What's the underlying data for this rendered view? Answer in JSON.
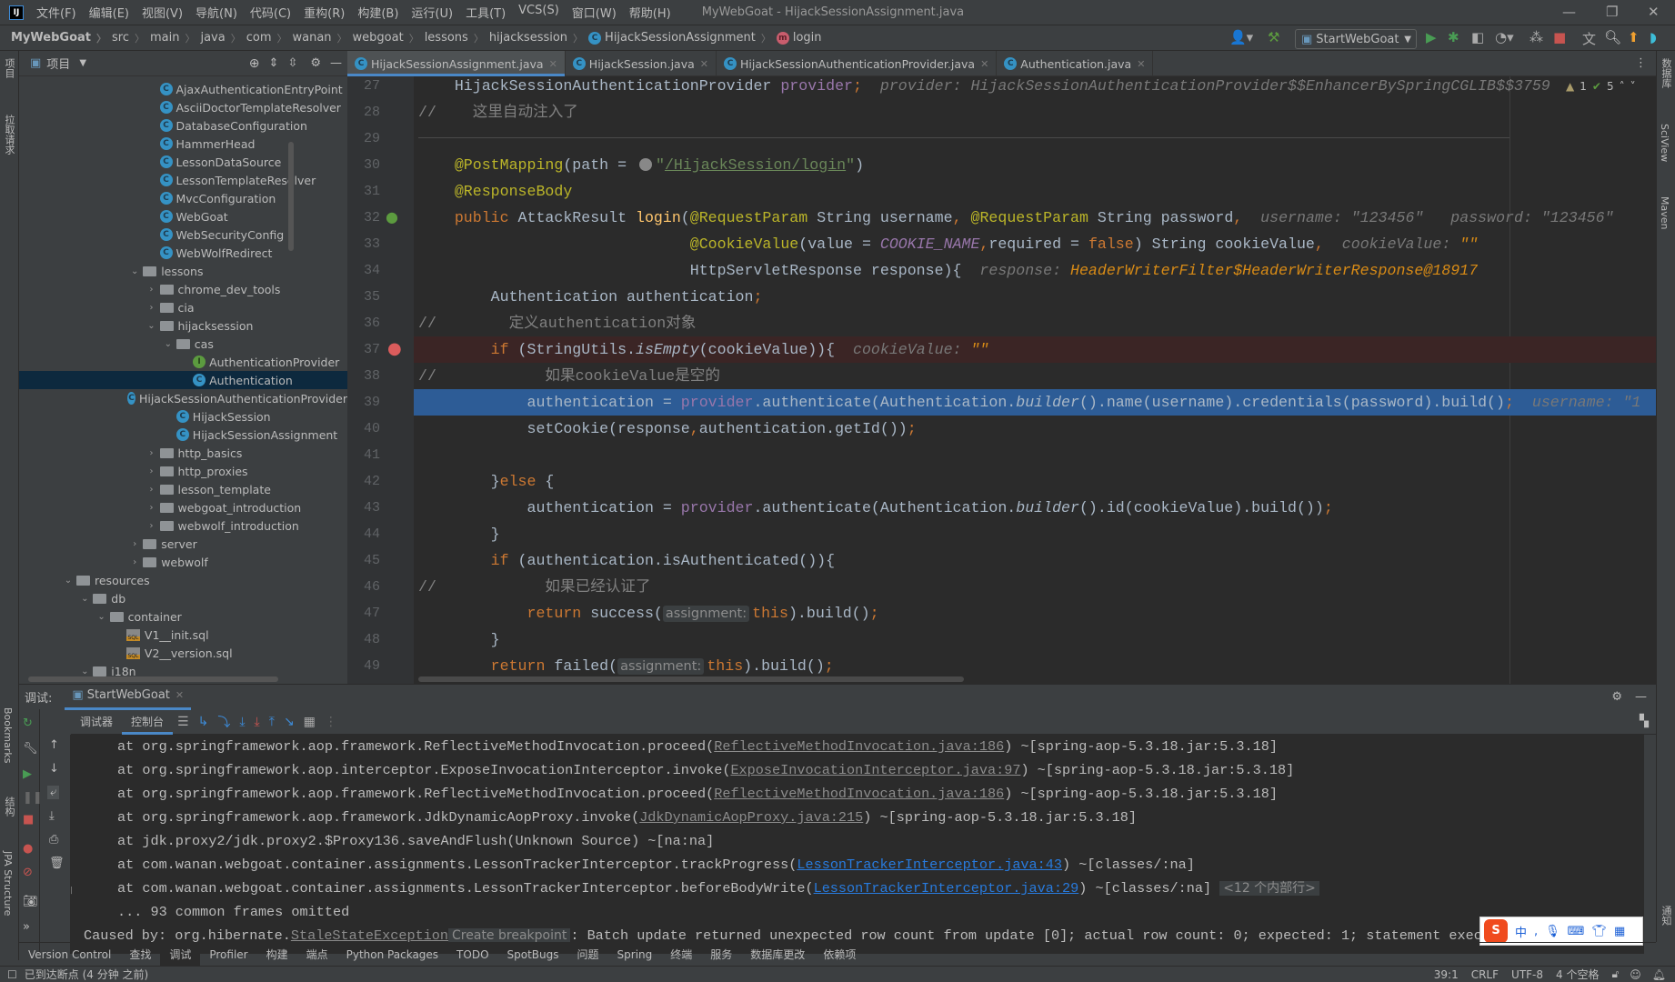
{
  "window": {
    "title": "MyWebGoat - HijackSessionAssignment.java",
    "logo": "IJ"
  },
  "menu": [
    "文件(F)",
    "编辑(E)",
    "视图(V)",
    "导航(N)",
    "代码(C)",
    "重构(R)",
    "构建(B)",
    "运行(U)",
    "工具(T)",
    "VCS(S)",
    "窗口(W)",
    "帮助(H)"
  ],
  "breadcrumb": [
    "MyWebGoat",
    "src",
    "main",
    "java",
    "com",
    "wanan",
    "webgoat",
    "lessons",
    "hijacksession"
  ],
  "breadcrumb_class": "HijackSessionAssignment",
  "breadcrumb_method": "login",
  "toolbar": {
    "run_config": "StartWebGoat"
  },
  "project": {
    "title": "项目",
    "tree": [
      {
        "label": "AjaxAuthenticationEntryPoint",
        "level": 5,
        "type": "class"
      },
      {
        "label": "AsciiDoctorTemplateResolver",
        "level": 5,
        "type": "class"
      },
      {
        "label": "DatabaseConfiguration",
        "level": 5,
        "type": "class"
      },
      {
        "label": "HammerHead",
        "level": 5,
        "type": "class"
      },
      {
        "label": "LessonDataSource",
        "level": 5,
        "type": "class"
      },
      {
        "label": "LessonTemplateResolver",
        "level": 5,
        "type": "class"
      },
      {
        "label": "MvcConfiguration",
        "level": 5,
        "type": "class"
      },
      {
        "label": "WebGoat",
        "level": 5,
        "type": "class"
      },
      {
        "label": "WebSecurityConfig",
        "level": 5,
        "type": "class"
      },
      {
        "label": "WebWolfRedirect",
        "level": 5,
        "type": "class"
      },
      {
        "label": "lessons",
        "level": 4,
        "type": "folder",
        "expanded": true
      },
      {
        "label": "chrome_dev_tools",
        "level": 5,
        "type": "folder",
        "expanded": false
      },
      {
        "label": "cia",
        "level": 5,
        "type": "folder",
        "expanded": false
      },
      {
        "label": "hijacksession",
        "level": 5,
        "type": "folder",
        "expanded": true
      },
      {
        "label": "cas",
        "level": 6,
        "type": "folder",
        "expanded": true
      },
      {
        "label": "AuthenticationProvider",
        "level": 7,
        "type": "interface"
      },
      {
        "label": "Authentication",
        "level": 7,
        "type": "class",
        "selected": true
      },
      {
        "label": "HijackSessionAuthenticationProvider",
        "level": 7,
        "type": "class"
      },
      {
        "label": "HijackSession",
        "level": 6,
        "type": "class"
      },
      {
        "label": "HijackSessionAssignment",
        "level": 6,
        "type": "class"
      },
      {
        "label": "http_basics",
        "level": 5,
        "type": "folder",
        "expanded": false
      },
      {
        "label": "http_proxies",
        "level": 5,
        "type": "folder",
        "expanded": false
      },
      {
        "label": "lesson_template",
        "level": 5,
        "type": "folder",
        "expanded": false
      },
      {
        "label": "webgoat_introduction",
        "level": 5,
        "type": "folder",
        "expanded": false
      },
      {
        "label": "webwolf_introduction",
        "level": 5,
        "type": "folder",
        "expanded": false
      },
      {
        "label": "server",
        "level": 4,
        "type": "folder",
        "expanded": false
      },
      {
        "label": "webwolf",
        "level": 4,
        "type": "folder",
        "expanded": false
      },
      {
        "label": "resources",
        "level": 0,
        "type": "folder",
        "expanded": true
      },
      {
        "label": "db",
        "level": 1,
        "type": "folder",
        "expanded": true
      },
      {
        "label": "container",
        "level": 2,
        "type": "folder",
        "expanded": true
      },
      {
        "label": "V1__init.sql",
        "level": 3,
        "type": "sql"
      },
      {
        "label": "V2__version.sql",
        "level": 3,
        "type": "sql"
      },
      {
        "label": "i18n",
        "level": 1,
        "type": "folder",
        "expanded": true
      }
    ]
  },
  "tabs": [
    {
      "label": "HijackSessionAssignment.java",
      "active": true
    },
    {
      "label": "HijackSession.java"
    },
    {
      "label": "HijackSessionAuthenticationProvider.java"
    },
    {
      "label": "Authentication.java"
    }
  ],
  "editor": {
    "inspections": {
      "warnings": "1",
      "ok": "5"
    },
    "breakpoint_line": 37,
    "current_line": 39,
    "lines": [
      {
        "n": 27,
        "t": [
          [
            "p",
            "    HijackSessionAuthenticationProvider "
          ],
          [
            "f",
            "provider"
          ],
          [
            "k",
            ";"
          ],
          [
            "h",
            "  provider: HijackSessionAuthenticationProvider$$EnhancerBySpringCGLIB$$3759"
          ]
        ]
      },
      {
        "n": 28,
        "t": [
          [
            "c",
            "//    这里自动注入了"
          ]
        ]
      },
      {
        "n": 29,
        "t": []
      },
      {
        "n": 30,
        "t": [
          [
            "a",
            "    @PostMapping"
          ],
          [
            "p",
            "(path = "
          ],
          [
            "g",
            ""
          ],
          [
            "s",
            "\""
          ],
          [
            "u",
            "/HijackSession/login"
          ],
          [
            "s",
            "\""
          ],
          [
            "p",
            ")"
          ]
        ]
      },
      {
        "n": 31,
        "t": [
          [
            "a",
            "    @ResponseBody"
          ]
        ]
      },
      {
        "n": 32,
        "t": [
          [
            "k",
            "    public "
          ],
          [
            "p",
            "AttackResult "
          ],
          [
            "m",
            "login"
          ],
          [
            "p",
            "("
          ],
          [
            "a",
            "@RequestParam "
          ],
          [
            "p",
            "String username"
          ],
          [
            "k",
            ", "
          ],
          [
            "a",
            "@RequestParam "
          ],
          [
            "p",
            "String password"
          ],
          [
            "k",
            ","
          ],
          [
            "h",
            "  username: \"123456\"   password: \"123456\""
          ]
        ]
      },
      {
        "n": 33,
        "t": [
          [
            "p",
            "                              "
          ],
          [
            "a",
            "@CookieValue"
          ],
          [
            "p",
            "(value = "
          ],
          [
            "fi",
            "COOKIE_NAME"
          ],
          [
            "k",
            ","
          ],
          [
            "p",
            "required = "
          ],
          [
            "k",
            "false"
          ],
          [
            "p",
            ") String cookieValue"
          ],
          [
            "k",
            ","
          ],
          [
            "h",
            "  cookieValue: "
          ],
          [
            "hv",
            "\"\""
          ]
        ]
      },
      {
        "n": 34,
        "t": [
          [
            "p",
            "                              HttpServletResponse response){"
          ],
          [
            "h",
            "  response: "
          ],
          [
            "hv",
            "HeaderWriterFilter$HeaderWriterResponse@18917"
          ]
        ]
      },
      {
        "n": 35,
        "t": [
          [
            "p",
            "        Authentication authentication"
          ],
          [
            "k",
            ";"
          ]
        ]
      },
      {
        "n": 36,
        "t": [
          [
            "c",
            "//        定义authentication对象"
          ]
        ]
      },
      {
        "n": 37,
        "t": [
          [
            "k",
            "        if "
          ],
          [
            "p",
            "(StringUtils."
          ],
          [
            "i",
            "isEmpty"
          ],
          [
            "p",
            "(cookieValue)){"
          ],
          [
            "h",
            "  cookieValue: "
          ],
          [
            "hv",
            "\"\""
          ]
        ]
      },
      {
        "n": 38,
        "t": [
          [
            "c",
            "//            如果cookieValue是空的"
          ]
        ]
      },
      {
        "n": 39,
        "t": [
          [
            "p",
            "            authentication = "
          ],
          [
            "f",
            "provider"
          ],
          [
            "p",
            ".authenticate(Authentication."
          ],
          [
            "i",
            "builder"
          ],
          [
            "p",
            "().name(username).credentials(password).build()"
          ],
          [
            "k",
            ";"
          ],
          [
            "h",
            "  username: \"1"
          ]
        ]
      },
      {
        "n": 40,
        "t": [
          [
            "p",
            "            setCookie(response"
          ],
          [
            "k",
            ","
          ],
          [
            "p",
            "authentication.getId())"
          ],
          [
            "k",
            ";"
          ]
        ]
      },
      {
        "n": 41,
        "t": []
      },
      {
        "n": 42,
        "t": [
          [
            "p",
            "        }"
          ],
          [
            "k",
            "else "
          ],
          [
            "p",
            "{"
          ]
        ]
      },
      {
        "n": 43,
        "t": [
          [
            "p",
            "            authentication = "
          ],
          [
            "f",
            "provider"
          ],
          [
            "p",
            ".authenticate(Authentication."
          ],
          [
            "i",
            "builder"
          ],
          [
            "p",
            "().id(cookieValue).build())"
          ],
          [
            "k",
            ";"
          ]
        ]
      },
      {
        "n": 44,
        "t": [
          [
            "p",
            "        }"
          ]
        ]
      },
      {
        "n": 45,
        "t": [
          [
            "k",
            "        if "
          ],
          [
            "p",
            "(authentication.isAuthenticated()){"
          ]
        ]
      },
      {
        "n": 46,
        "t": [
          [
            "c",
            "//            如果已经认证了"
          ]
        ]
      },
      {
        "n": 47,
        "t": [
          [
            "k",
            "            return "
          ],
          [
            "p",
            "success("
          ],
          [
            "b",
            "assignment:"
          ],
          [
            "k",
            "this"
          ],
          [
            "p",
            ").build()"
          ],
          [
            "k",
            ";"
          ]
        ]
      },
      {
        "n": 48,
        "t": [
          [
            "p",
            "        }"
          ]
        ]
      },
      {
        "n": 49,
        "t": [
          [
            "k",
            "        return "
          ],
          [
            "p",
            "failed("
          ],
          [
            "b",
            "assignment:"
          ],
          [
            "k",
            "this"
          ],
          [
            "p",
            ").build()"
          ],
          [
            "k",
            ";"
          ]
        ]
      }
    ]
  },
  "debug": {
    "label": "调试:",
    "session": "StartWebGoat",
    "tabs": [
      "调试器",
      "控制台"
    ],
    "console": [
      {
        "indent": true,
        "t": [
          [
            "p",
            "at org.springframework.aop.framework.ReflectiveMethodInvocation.proceed("
          ],
          [
            "l",
            "ReflectiveMethodInvocation.java:186"
          ],
          [
            "p",
            ") ~[spring-aop-5.3.18.jar:5.3.18]"
          ]
        ]
      },
      {
        "indent": true,
        "t": [
          [
            "p",
            "at org.springframework.aop.interceptor.ExposeInvocationInterceptor.invoke("
          ],
          [
            "l",
            "ExposeInvocationInterceptor.java:97"
          ],
          [
            "p",
            ") ~[spring-aop-5.3.18.jar:5.3.18]"
          ]
        ]
      },
      {
        "indent": true,
        "t": [
          [
            "p",
            "at org.springframework.aop.framework.ReflectiveMethodInvocation.proceed("
          ],
          [
            "l",
            "ReflectiveMethodInvocation.java:186"
          ],
          [
            "p",
            ") ~[spring-aop-5.3.18.jar:5.3.18]"
          ]
        ]
      },
      {
        "indent": true,
        "t": [
          [
            "p",
            "at org.springframework.aop.framework.JdkDynamicAopProxy.invoke("
          ],
          [
            "l",
            "JdkDynamicAopProxy.java:215"
          ],
          [
            "p",
            ") ~[spring-aop-5.3.18.jar:5.3.18]"
          ]
        ]
      },
      {
        "indent": true,
        "t": [
          [
            "p",
            "at jdk.proxy2/jdk.proxy2.$Proxy136.saveAndFlush(Unknown Source) ~[na:na]"
          ]
        ]
      },
      {
        "indent": true,
        "t": [
          [
            "p",
            "at com.wanan.webgoat.container.assignments.LessonTrackerInterceptor.trackProgress("
          ],
          [
            "lb",
            "LessonTrackerInterceptor.java:43"
          ],
          [
            "p",
            ") ~[classes/:na]"
          ]
        ]
      },
      {
        "indent": true,
        "t": [
          [
            "p",
            "at com.wanan.webgoat.container.assignments.LessonTrackerInterceptor.beforeBodyWrite("
          ],
          [
            "lb",
            "LessonTrackerInterceptor.java:29"
          ],
          [
            "p",
            ") ~[classes/:na] "
          ],
          [
            "b",
            "<12 个内部行>"
          ]
        ]
      },
      {
        "indent": true,
        "t": [
          [
            "p",
            "... 93 common frames omitted"
          ]
        ]
      },
      {
        "indent": false,
        "t": [
          [
            "p",
            "Caused by: org.hibernate."
          ],
          [
            "l",
            "StaleStateException"
          ],
          [
            "b",
            "Create breakpoint"
          ],
          [
            "p",
            ": Batch update returned unexpected row count from update [0]; actual row count: 0; expected: 1; statement exec"
          ]
        ]
      }
    ]
  },
  "left_strip": {
    "top": [
      "项目",
      "拉取请求"
    ],
    "bottom": [
      "Bookmarks",
      "结构",
      "JPA Structure"
    ]
  },
  "right_strip": [
    "数据库",
    "SciView",
    "Maven",
    "通知"
  ],
  "bottom_tools": [
    {
      "label": "Version Control"
    },
    {
      "label": "查找"
    },
    {
      "label": "调试",
      "active": true
    },
    {
      "label": "Profiler"
    },
    {
      "label": "构建"
    },
    {
      "label": "端点"
    },
    {
      "label": "Python Packages"
    },
    {
      "label": "TODO"
    },
    {
      "label": "SpotBugs"
    },
    {
      "label": "问题"
    },
    {
      "label": "Spring"
    },
    {
      "label": "终端"
    },
    {
      "label": "服务"
    },
    {
      "label": "数据库更改"
    },
    {
      "label": "依赖项"
    }
  ],
  "status": {
    "message": "已到达断点 (4 分钟 之前)",
    "position": "39:1",
    "line_sep": "CRLF",
    "encoding": "UTF-8",
    "indent": "4 个空格"
  },
  "ime": {
    "mode": "中"
  }
}
